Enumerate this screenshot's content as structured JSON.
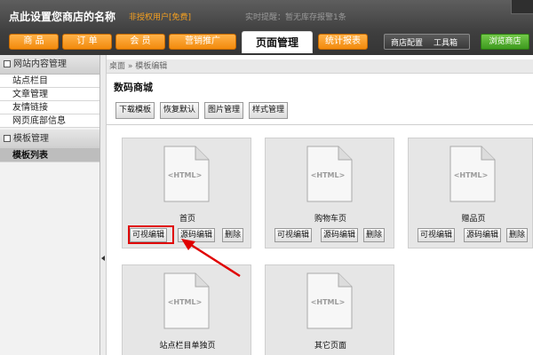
{
  "header": {
    "shop_name": "点此设置您商店的名称",
    "user_tag": "非授权用户[免费]",
    "notice": "实时提醒：暂无库存报警1条",
    "nav": [
      "商 品",
      "订 单",
      "会 员",
      "营销推广",
      "页面管理",
      "统计报表"
    ],
    "shop_config": "商店配置",
    "toolbox": "工具箱",
    "view_shop": "浏览商店"
  },
  "sidebar": {
    "group1": "网站内容管理",
    "items1": [
      "站点栏目",
      "文章管理",
      "友情链接",
      "网页底部信息"
    ],
    "group2": "模板管理",
    "items2": [
      "模板列表"
    ]
  },
  "main": {
    "breadcrumb": "桌面 » 模板编辑",
    "title": "数码商城",
    "toolbar": [
      "下载模板",
      "恢复默认",
      "图片管理",
      "样式管理"
    ],
    "doc_label": "<HTML>",
    "cards": [
      {
        "name": "首页",
        "buttons": [
          "可视编辑",
          "源码编辑",
          "删除"
        ]
      },
      {
        "name": "购物车页",
        "buttons": [
          "可视编辑",
          "源码编辑",
          "删除"
        ]
      },
      {
        "name": "赠品页",
        "buttons": [
          "可视编辑",
          "源码编辑",
          "删除"
        ]
      },
      {
        "name": "站点栏目单独页",
        "buttons": []
      },
      {
        "name": "其它页面",
        "buttons": []
      }
    ]
  },
  "colors": {
    "accent_orange": "#f28a0c",
    "header_dark": "#3e3e3e",
    "highlight_red": "#e00000",
    "view_green": "#3d9a1e"
  }
}
